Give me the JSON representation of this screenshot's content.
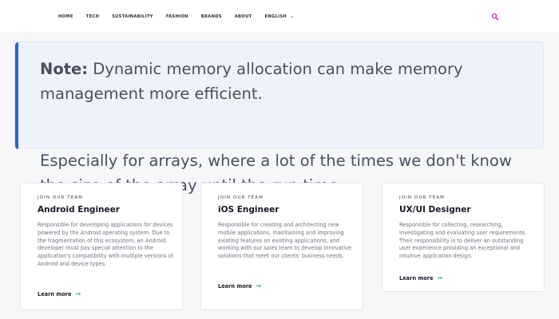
{
  "nav": {
    "items": [
      "HOME",
      "TECH",
      "SUSTAINABILITY",
      "FASHION",
      "BRANDS",
      "ABOUT",
      "ENGLISH"
    ],
    "search_icon": "search-icon",
    "accent": "#c026a5"
  },
  "note": {
    "label": "Note:",
    "text1": " Dynamic memory allocation can make memory management more efficient.",
    "text2": "Especially for arrays, where a lot of the times we don't know the size of the array until the run time.",
    "accent": "#2563d9"
  },
  "cards": [
    {
      "kicker": "JOIN OUR TEAM",
      "title": "Android Engineer",
      "desc": "Responsible for developing applications for devices powered by the Android operating system. Due to the fragmentation of this ecosystem, an Android developer must pay special attention to the application's compatibility with multiple versions of Android and device types.",
      "link": "Learn more"
    },
    {
      "kicker": "JOIN OUR TEAM",
      "title": "iOS Engineer",
      "desc": "Responsible for creating and architecting new mobile applications, maintaining and improving existing features on existing applications, and working with our sales team to develop innovative solutions that meet our clients' business needs.",
      "link": "Learn more"
    },
    {
      "kicker": "JOIN OUR TEAM",
      "title": "UX/UI Designer",
      "desc": "Responsible for collecting, researching, investigating and evaluating user requirements. Their responsibility is to deliver an outstanding user experience providing an exceptional and intuitive application design.",
      "link": "Learn more"
    }
  ],
  "colors": {
    "link_arrow": "#1fb78a"
  }
}
